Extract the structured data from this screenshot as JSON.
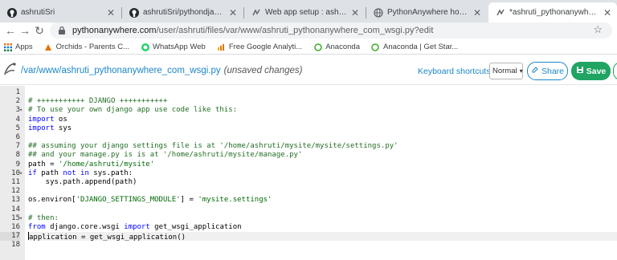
{
  "browser": {
    "tabs": [
      {
        "title": "ashrutiSri",
        "icon": "github-icon"
      },
      {
        "title": "ashrutiSri/pythondjango: Djan",
        "icon": "github-icon"
      },
      {
        "title": "Web app setup : ashruti : Pyth",
        "icon": "pythonanywhere-icon"
      },
      {
        "title": "PythonAnywhere hosted web a",
        "icon": "pythonanywhere-icon"
      },
      {
        "title": "*ashruti_pythonanywhere_com",
        "icon": "pythonanywhere-icon",
        "active": true
      }
    ],
    "address": {
      "host": "pythonanywhere.com",
      "path": "/user/ashruti/files/var/www/ashruti_pythonanywhere_com_wsgi.py?edit"
    },
    "bookmarks": [
      {
        "label": "Apps",
        "icon": "apps-grid-icon"
      },
      {
        "label": "Orchids - Parents C...",
        "icon": "orchids-icon"
      },
      {
        "label": "WhatsApp Web",
        "icon": "whatsapp-icon"
      },
      {
        "label": "Free Google Analyti...",
        "icon": "analytics-icon"
      },
      {
        "label": "Anaconda",
        "icon": "anaconda-icon"
      },
      {
        "label": "Anaconda | Get Star...",
        "icon": "anaconda-icon"
      }
    ]
  },
  "editor_header": {
    "filepath": "/var/www/ashruti_pythonanywhere_com_wsgi.py",
    "status": "(unsaved changes)",
    "keyboard_label": "Keyboard shortcuts:",
    "keyboard_mode": "Normal",
    "share_label": "Share",
    "save_label": "Save"
  },
  "code": {
    "current_line": 17,
    "lines": [
      {
        "n": "1",
        "fold": "",
        "text": ""
      },
      {
        "n": "2",
        "fold": "",
        "text": "# +++++++++++ DJANGO +++++++++++"
      },
      {
        "n": "3",
        "fold": "▾",
        "text": "# To use your own django app use code like this:"
      },
      {
        "n": "4",
        "fold": "",
        "text": "import os"
      },
      {
        "n": "5",
        "fold": "",
        "text": "import sys"
      },
      {
        "n": "6",
        "fold": "",
        "text": ""
      },
      {
        "n": "7",
        "fold": "",
        "text": "## assuming your django settings file is at '/home/ashruti/mysite/mysite/settings.py'"
      },
      {
        "n": "8",
        "fold": "",
        "text": "## and your manage.py is is at '/home/ashruti/mysite/manage.py'"
      },
      {
        "n": "9",
        "fold": "",
        "text": "path = '/home/ashruti/mysite'"
      },
      {
        "n": "10",
        "fold": "▾",
        "text": "if path not in sys.path:"
      },
      {
        "n": "11",
        "fold": "",
        "text": "    sys.path.append(path)"
      },
      {
        "n": "12",
        "fold": "",
        "text": ""
      },
      {
        "n": "13",
        "fold": "",
        "text": "os.environ['DJANGO_SETTINGS_MODULE'] = 'mysite.settings'"
      },
      {
        "n": "14",
        "fold": "",
        "text": ""
      },
      {
        "n": "15",
        "fold": "▾",
        "text": "# then:"
      },
      {
        "n": "16",
        "fold": "",
        "text": "from django.core.wsgi import get_wsgi_application"
      },
      {
        "n": "17",
        "fold": "",
        "text": "application = get_wsgi_application()"
      },
      {
        "n": "18",
        "fold": "",
        "text": ""
      }
    ]
  },
  "colors": {
    "link_blue": "#1b87c9",
    "save_green": "#1fa463",
    "keyword": "#0000ff",
    "comment": "#236e24",
    "string": "#036a07"
  }
}
